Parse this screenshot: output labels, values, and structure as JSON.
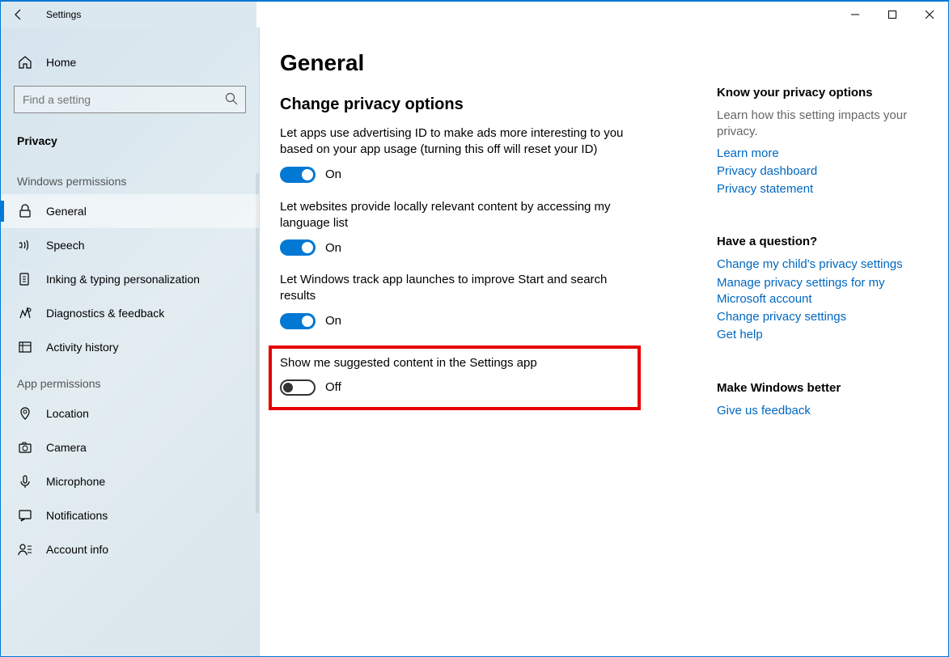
{
  "titlebar": {
    "app_name": "Settings"
  },
  "sidebar": {
    "home_label": "Home",
    "search_placeholder": "Find a setting",
    "category_label": "Privacy",
    "group1_label": "Windows permissions",
    "group2_label": "App permissions",
    "items_win": [
      {
        "id": "general",
        "label": "General",
        "active": true
      },
      {
        "id": "speech",
        "label": "Speech"
      },
      {
        "id": "inking",
        "label": "Inking & typing personalization"
      },
      {
        "id": "diagnostics",
        "label": "Diagnostics & feedback"
      },
      {
        "id": "activity",
        "label": "Activity history"
      }
    ],
    "items_app": [
      {
        "id": "location",
        "label": "Location"
      },
      {
        "id": "camera",
        "label": "Camera"
      },
      {
        "id": "microphone",
        "label": "Microphone"
      },
      {
        "id": "notifications",
        "label": "Notifications"
      },
      {
        "id": "accountinfo",
        "label": "Account info"
      }
    ]
  },
  "main": {
    "title": "General",
    "section_title": "Change privacy options",
    "settings": [
      {
        "desc": "Let apps use advertising ID to make ads more interesting to you based on your app usage (turning this off will reset your ID)",
        "on": true,
        "state": "On"
      },
      {
        "desc": "Let websites provide locally relevant content by accessing my language list",
        "on": true,
        "state": "On"
      },
      {
        "desc": "Let Windows track app launches to improve Start and search results",
        "on": true,
        "state": "On"
      },
      {
        "desc": "Show me suggested content in the Settings app",
        "on": false,
        "state": "Off",
        "highlight": true
      }
    ]
  },
  "right": {
    "s1_title": "Know your privacy options",
    "s1_text": "Learn how this setting impacts your privacy.",
    "s1_links": [
      "Learn more",
      "Privacy dashboard",
      "Privacy statement"
    ],
    "s2_title": "Have a question?",
    "s2_links": [
      "Change my child's privacy settings",
      "Manage privacy settings for my Microsoft account",
      "Change privacy settings",
      "Get help"
    ],
    "s3_title": "Make Windows better",
    "s3_links": [
      "Give us feedback"
    ]
  }
}
